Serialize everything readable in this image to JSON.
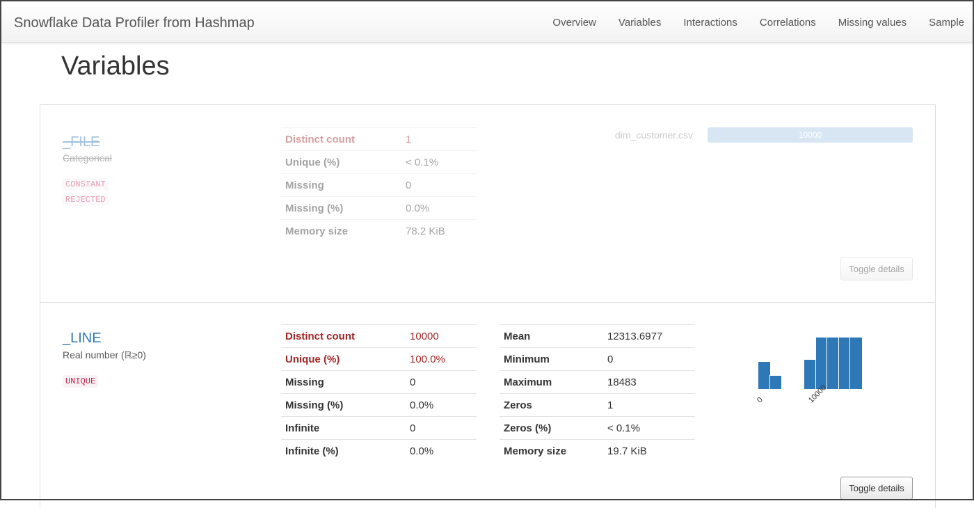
{
  "navbar": {
    "brand": "Snowflake Data Profiler from Hashmap",
    "items": [
      "Overview",
      "Variables",
      "Interactions",
      "Correlations",
      "Missing values",
      "Sample"
    ]
  },
  "page_title": "Variables",
  "variables": [
    {
      "name": "_FILE",
      "type": "Categorical",
      "badges": [
        "CONSTANT",
        "REJECTED"
      ],
      "stats": [
        {
          "label": "Distinct count",
          "value": "1"
        },
        {
          "label": "Unique (%)",
          "value": "< 0.1%"
        },
        {
          "label": "Missing",
          "value": "0"
        },
        {
          "label": "Missing (%)",
          "value": "0.0%"
        },
        {
          "label": "Memory size",
          "value": "78.2 KiB"
        }
      ],
      "frequency": {
        "label": "dim_customer.csv",
        "count": "10000"
      },
      "toggle_label": "Toggle details"
    },
    {
      "name": "_LINE",
      "type": "Real number (ℝ≥0)",
      "badges": [
        "UNIQUE"
      ],
      "stats": [
        {
          "label": "Distinct count",
          "value": "10000"
        },
        {
          "label": "Unique (%)",
          "value": "100.0%"
        },
        {
          "label": "Missing",
          "value": "0"
        },
        {
          "label": "Missing (%)",
          "value": "0.0%"
        },
        {
          "label": "Infinite",
          "value": "0"
        },
        {
          "label": "Infinite (%)",
          "value": "0.0%"
        }
      ],
      "stats2": [
        {
          "label": "Mean",
          "value": "12313.6977"
        },
        {
          "label": "Minimum",
          "value": "0"
        },
        {
          "label": "Maximum",
          "value": "18483"
        },
        {
          "label": "Zeros",
          "value": "1"
        },
        {
          "label": "Zeros (%)",
          "value": "< 0.1%"
        },
        {
          "label": "Memory size",
          "value": "19.7 KiB"
        }
      ],
      "toggle_label": "Toggle details"
    }
  ],
  "colors": {
    "accent": "#2e78b7",
    "highlight": "#a02626",
    "badge_text": "#c7254e"
  },
  "chart_data": {
    "type": "bar",
    "title": "",
    "xlabel": "",
    "ylabel": "",
    "x_ticks": [
      "0",
      "10000"
    ],
    "bins": [
      {
        "x": 0,
        "height": 0.53
      },
      {
        "x": 1,
        "height": 0.26
      },
      {
        "x": 2,
        "height": 0
      },
      {
        "x": 3,
        "height": 0
      },
      {
        "x": 4,
        "height": 0.57
      },
      {
        "x": 5,
        "height": 1.0
      },
      {
        "x": 6,
        "height": 1.0
      },
      {
        "x": 7,
        "height": 1.0
      },
      {
        "x": 8,
        "height": 1.0
      }
    ]
  }
}
